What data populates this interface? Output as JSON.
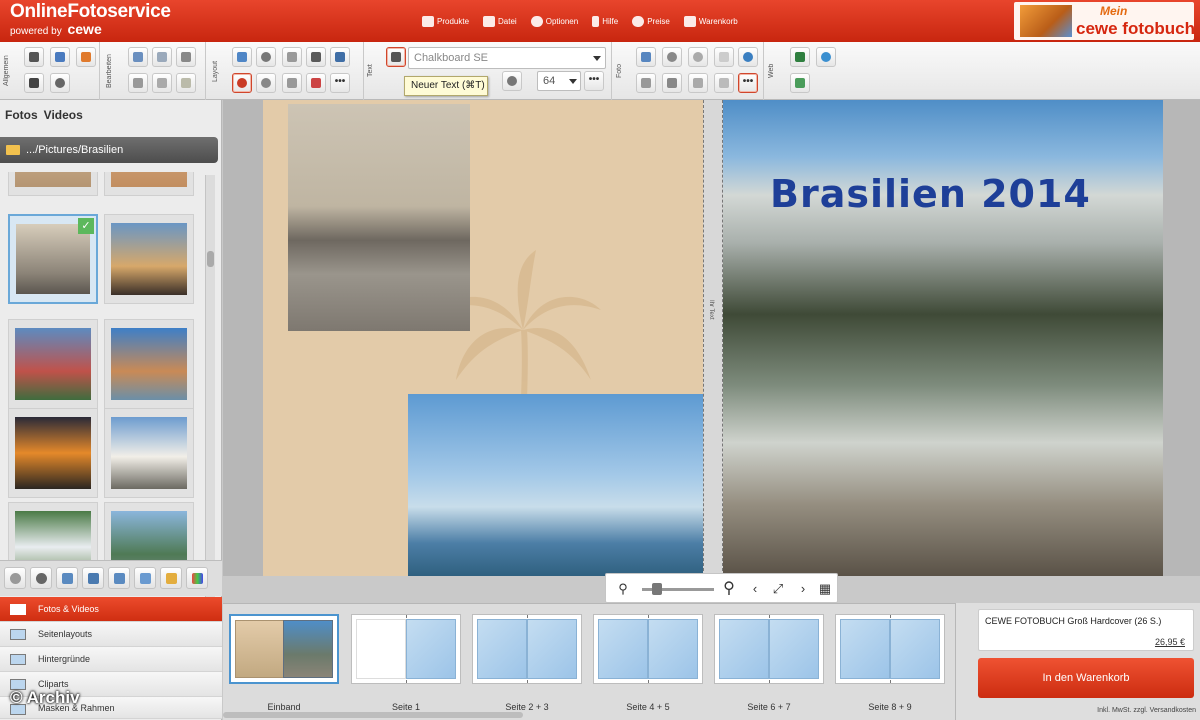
{
  "brand": {
    "name": "OnlineFotoservice",
    "powered_by": "powered by",
    "powered_brand": "cewe"
  },
  "nav": [
    {
      "icon": "wand-icon",
      "label": "Produkte"
    },
    {
      "icon": "folder-icon",
      "label": "Datei"
    },
    {
      "icon": "gear-icon",
      "label": "Optionen"
    },
    {
      "icon": "question-icon",
      "label": "Hilfe"
    },
    {
      "icon": "coins-icon",
      "label": "Preise"
    },
    {
      "icon": "cart-icon",
      "label": "Warenkorb"
    }
  ],
  "cewe_logo": {
    "mein": "Mein",
    "fotobuch": "cewe fotobuch"
  },
  "toolbar": {
    "groups": [
      "Allgemein",
      "Bearbeiten",
      "Layout",
      "Text",
      "Foto",
      "Web"
    ],
    "font": "Chalkboard SE",
    "font_size": "64",
    "more": "•••",
    "tooltip": "Neuer Text (⌘T)"
  },
  "left": {
    "tabs": [
      "Fotos",
      "Videos"
    ],
    "folder": ".../Pictures/Brasilien",
    "menu": [
      {
        "label": "Fotos & Videos",
        "active": true
      },
      {
        "label": "Seitenlayouts"
      },
      {
        "label": "Hintergründe"
      },
      {
        "label": "Cliparts"
      },
      {
        "label": "Masken & Rahmen"
      }
    ],
    "watermark": "© Archiv"
  },
  "canvas": {
    "cover_title": "Brasilien 2014",
    "spine_label": "Ihr Text"
  },
  "pages": [
    "Einband",
    "Seite 1",
    "Seite 2 + 3",
    "Seite 4 + 5",
    "Seite 6 + 7",
    "Seite 8 + 9"
  ],
  "order": {
    "product": "CEWE FOTOBUCH Groß Hardcover  (26 S.)",
    "price": "26,95 €",
    "button": "In den Warenkorb",
    "tax": "Inkl. MwSt. zzgl. Versandkosten"
  },
  "colors": {
    "accent": "#d8351a",
    "cover_title": "#1e3f98",
    "selection": "#4b94cf"
  }
}
